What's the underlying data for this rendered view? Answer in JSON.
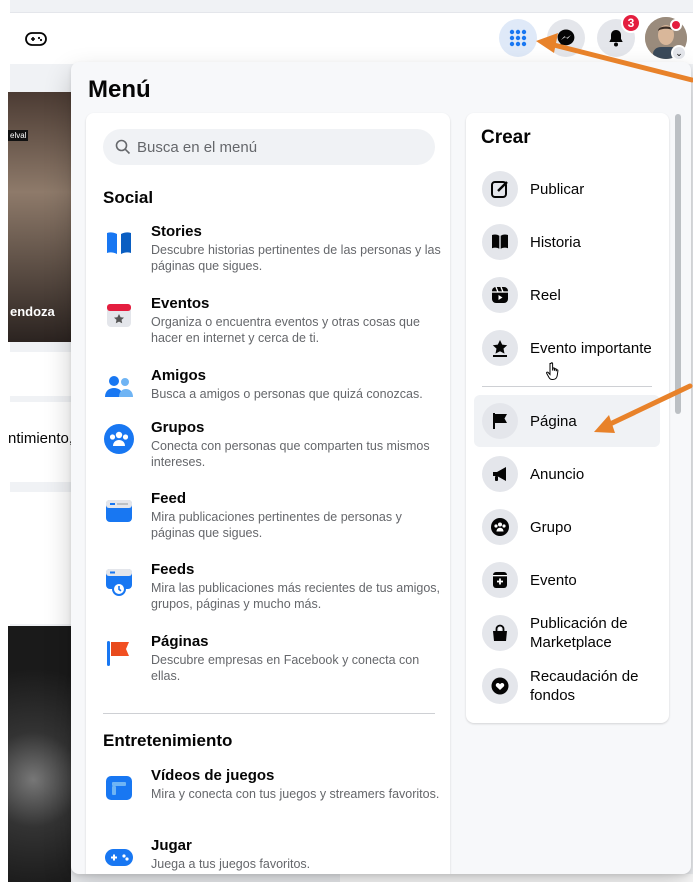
{
  "topbar": {
    "notification_count": "3",
    "icons": [
      "gamepad-icon",
      "grid-menu-icon",
      "messenger-icon",
      "bell-icon",
      "avatar"
    ]
  },
  "background": {
    "video_name_fragment": "endoza",
    "video_tag": "elval",
    "post_text_fragment": "ntimiento,"
  },
  "menu": {
    "title": "Menú",
    "search_placeholder": "Busca en el menú",
    "social_heading": "Social",
    "social_items": [
      {
        "title": "Stories",
        "desc": "Descubre historias pertinentes de las personas y las páginas que sigues."
      },
      {
        "title": "Eventos",
        "desc": "Organiza o encuentra eventos y otras cosas que hacer en internet y cerca de ti."
      },
      {
        "title": "Amigos",
        "desc": "Busca a amigos o personas que quizá conozcas."
      },
      {
        "title": "Grupos",
        "desc": "Conecta con personas que comparten tus mismos intereses."
      },
      {
        "title": "Feed",
        "desc": "Mira publicaciones pertinentes de personas y páginas que sigues."
      },
      {
        "title": "Feeds",
        "desc": "Mira las publicaciones más recientes de tus amigos, grupos, páginas y mucho más."
      },
      {
        "title": "Páginas",
        "desc": "Descubre empresas en Facebook y conecta con ellas."
      }
    ],
    "entertainment_heading": "Entretenimiento",
    "entertainment_items": [
      {
        "title": "Vídeos de juegos",
        "desc": "Mira y conecta con tus juegos y streamers favoritos."
      },
      {
        "title": "Jugar",
        "desc": "Juega a tus juegos favoritos."
      }
    ],
    "create_heading": "Crear",
    "create_items": [
      {
        "label": "Publicar"
      },
      {
        "label": "Historia"
      },
      {
        "label": "Reel"
      },
      {
        "label": "Evento importante"
      },
      {
        "label": "Página"
      },
      {
        "label": "Anuncio"
      },
      {
        "label": "Grupo"
      },
      {
        "label": "Evento"
      },
      {
        "label": "Publicación de Marketplace"
      },
      {
        "label": "Recaudación de fondos"
      }
    ]
  },
  "colors": {
    "accent": "#1877f2",
    "annotation_arrow": "#e8822a",
    "badge": "#e41e3f"
  }
}
